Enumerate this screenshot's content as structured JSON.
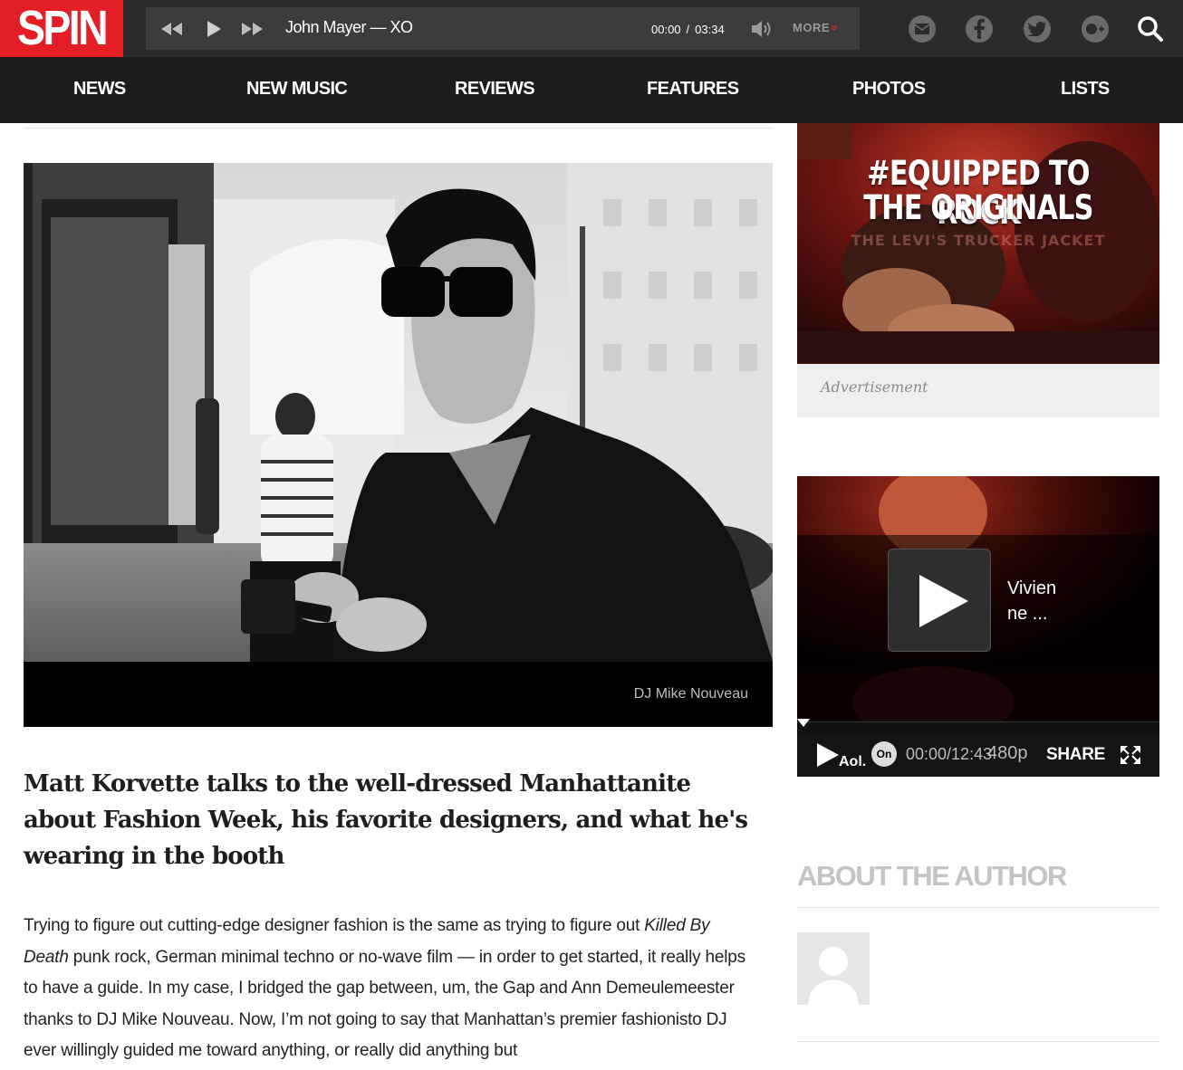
{
  "brand": {
    "logo": "SPIN",
    "accent": "#e41e26"
  },
  "player": {
    "track": "John Mayer — XO",
    "current_time": "00:00",
    "separator": "/",
    "duration": "03:34",
    "more_label": "MORE",
    "more_icon": "»"
  },
  "header_icons": [
    "mail-icon",
    "facebook-icon",
    "twitter-icon",
    "google-plus-icon",
    "search-icon"
  ],
  "nav": [
    "NEWS",
    "NEW MUSIC",
    "REVIEWS",
    "FEATURES",
    "PHOTOS",
    "LISTS"
  ],
  "article": {
    "photo_caption": "DJ Mike Nouveau",
    "dek": "Matt Korvette talks to the well-dressed Manhattanite about Fashion Week, his favorite designers, and what he's wearing in the booth",
    "body": {
      "p1": "Trying to figure out cutting-edge designer fashion is the same as trying to figure out ",
      "em1": "Killed By Death",
      "p2": " punk rock, German minimal techno or no-wave film — in order to get started, it really helps to have a guide. In my case, I bridged the gap between, um, the Gap and Ann Demeulemeester thanks to DJ Mike Nouveau. Now, I’m not going to say that Manhattan’s premier fashionisto DJ ever willingly guided me toward anything, or really did anything but"
    }
  },
  "sidebar": {
    "ad": {
      "line1": "#EQUIPPED TO ROCK",
      "line2": "THE ORIGINALS",
      "sub": "THE LEVI'S TRUCKER JACKET",
      "label": "Advertisement"
    },
    "video": {
      "title": "Vivien ne ...",
      "brand": "Aol.",
      "badge": "On",
      "time": "00:00/12:43",
      "quality": "480p",
      "share": "SHARE"
    },
    "author_heading": "ABOUT THE AUTHOR"
  }
}
